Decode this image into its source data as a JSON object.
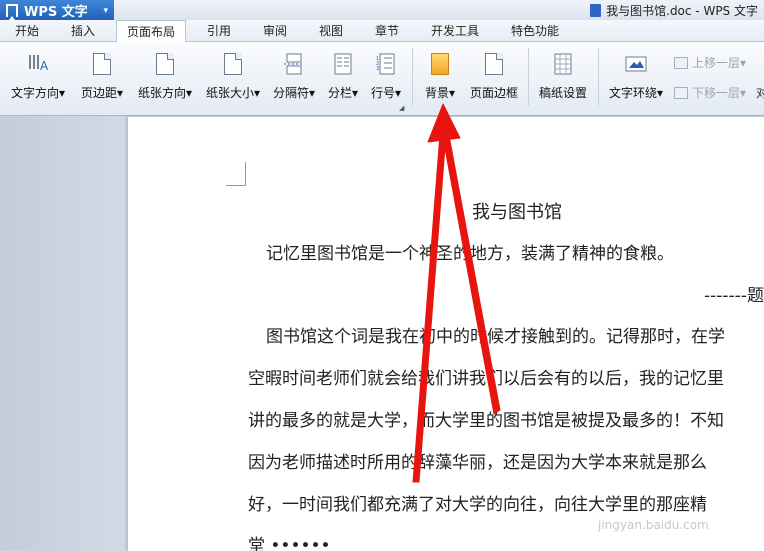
{
  "app": {
    "name": "WPS 文字",
    "dropdown": "▾"
  },
  "document_title": "我与图书馆.doc - WPS 文字",
  "menu": {
    "tabs": [
      {
        "label": "开始"
      },
      {
        "label": "插入"
      },
      {
        "label": "页面布局"
      },
      {
        "label": "引用"
      },
      {
        "label": "审阅"
      },
      {
        "label": "视图"
      },
      {
        "label": "章节"
      },
      {
        "label": "开发工具"
      },
      {
        "label": "特色功能"
      }
    ],
    "active": "页面布局"
  },
  "ribbon": {
    "text_direction": "文字方向",
    "margins": "页边距",
    "orientation": "纸张方向",
    "paper_size": "纸张大小",
    "breaks": "分隔符",
    "columns": "分栏",
    "line_numbers": "行号",
    "background": "背景",
    "page_border": "页面边框",
    "manuscript": "稿纸设置",
    "text_wrap": "文字环绕",
    "bring_forward": "上移一层",
    "send_backward": "下移一层",
    "dropdown_caret": "▾",
    "truncated_label": "对"
  },
  "document": {
    "title": "我与图书馆",
    "epigraph": "记忆里图书馆是一个神圣的地方，装满了精神的食粮。",
    "epigraph_sig": "-------题",
    "lines": [
      "图书馆这个词是我在初中的时候才接触到的。记得那时，在学",
      "空暇时间老师们就会给我们讲我们以后会有的以后，我的记忆里",
      "讲的最多的就是大学，而大学里的图书馆是被提及最多的！不知",
      "因为老师描述时所用的辞藻华丽，还是因为大学本来就是那么",
      "好，一时间我们都充满了对大学的向往，向往大学里的那座精",
      "堂 ••••••"
    ]
  },
  "watermark": "jingyan.baidu.com",
  "colors": {
    "arrow": "#e8140f",
    "app_blue": "#2a6fc9"
  }
}
